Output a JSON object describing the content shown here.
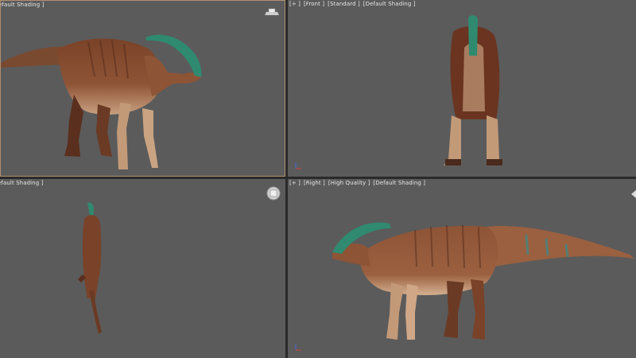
{
  "viewports": {
    "top_left": {
      "label_parts": [
        "efault Shading ]"
      ],
      "gizmo": "viewcube-icon"
    },
    "top_right": {
      "label_parts": [
        "[+ ]",
        "[Front ]",
        "[Standard ]",
        "[Default Shading ]"
      ]
    },
    "bottom_left": {
      "label_parts": [
        "efault Shading ]"
      ],
      "gizmo": "steering-wheel-icon"
    },
    "bottom_right": {
      "label_parts": [
        "[+ ]",
        "[Right ]",
        "[High Quality ]",
        "[Default Shading ]"
      ]
    }
  },
  "colors": {
    "viewport_bg": "#5b5b5b",
    "active_border": "#b09070",
    "skin_dark": "#5a2f1e",
    "skin_mid": "#8a4f34",
    "skin_light": "#c89c7c",
    "crest": "#2f8a70"
  }
}
